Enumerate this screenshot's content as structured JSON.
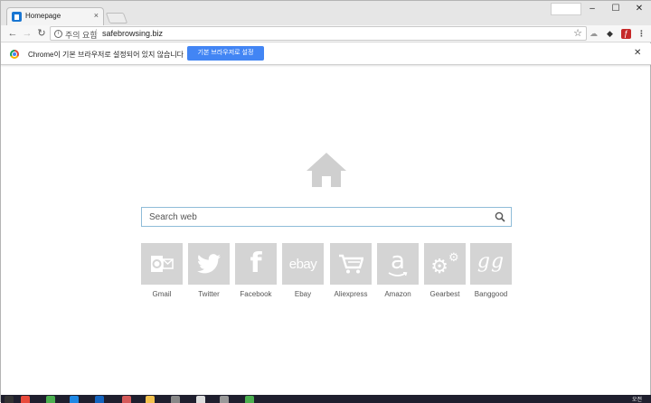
{
  "tab": {
    "title": "Homepage",
    "close": "×"
  },
  "window": {
    "minimize": "–",
    "maximize": "☐",
    "close": "✕"
  },
  "toolbar": {
    "back": "←",
    "forward": "→",
    "reload": "↻",
    "security_label": "주의 요함",
    "url": "safebrowsing.biz",
    "star": "☆",
    "menu": "⋮"
  },
  "infobar": {
    "message": "Chrome이 기본 브라우저로 설정되어 있지 않습니다",
    "button_label": "기본 브라우저로 설정",
    "close": "✕"
  },
  "search": {
    "placeholder": "Search web"
  },
  "shortcuts": [
    {
      "label": "Gmail",
      "glyph": "O✉",
      "icon": "outlook-icon"
    },
    {
      "label": "Twitter",
      "glyph": "",
      "icon": "twitter-bird-icon"
    },
    {
      "label": "Facebook",
      "glyph": "f",
      "icon": "facebook-f-icon"
    },
    {
      "label": "Ebay",
      "glyph": "ebay",
      "icon": "ebay-icon"
    },
    {
      "label": "Aliexpress",
      "glyph": "",
      "icon": "shopping-cart-icon"
    },
    {
      "label": "Amazon",
      "glyph": "a",
      "icon": "amazon-icon"
    },
    {
      "label": "Gearbest",
      "glyph": "⚙",
      "icon": "gears-icon"
    },
    {
      "label": "Banggood",
      "glyph": "gg",
      "icon": "banggood-icon"
    }
  ],
  "taskbar": {
    "clock": "오전"
  },
  "colors": {
    "accent_blue": "#4285f4",
    "tile_gray": "#d4d4d4",
    "icon_gray": "#cfcfcf"
  }
}
